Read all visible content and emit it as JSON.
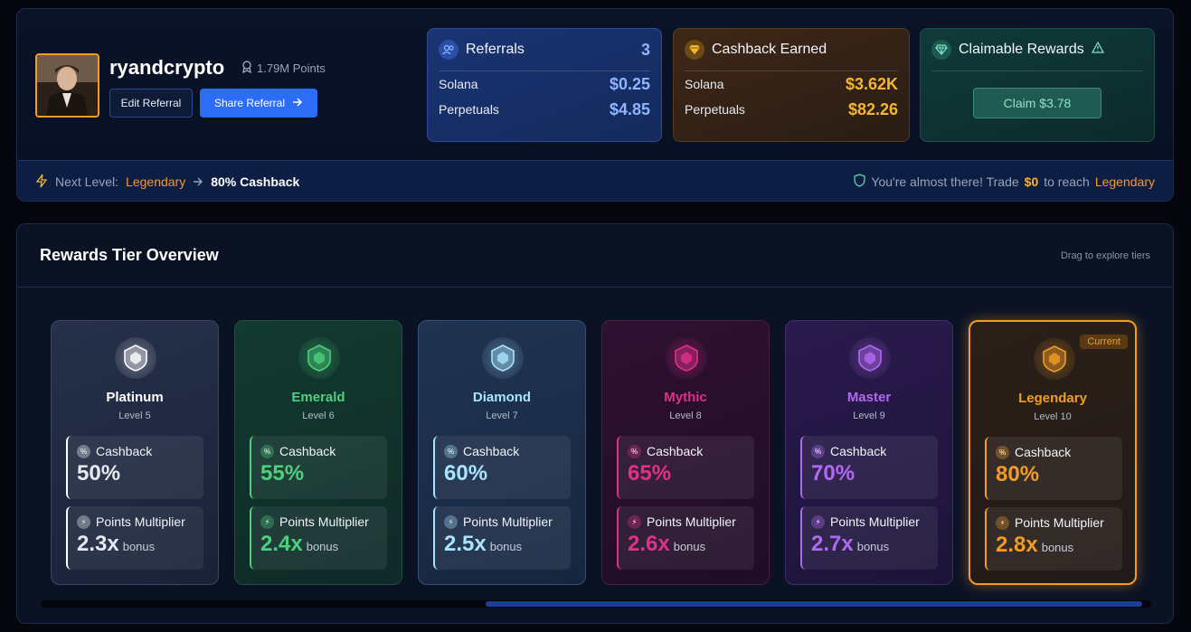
{
  "profile": {
    "username": "ryandcrypto",
    "points": "1.79M Points",
    "edit_label": "Edit Referral",
    "share_label": "Share Referral"
  },
  "referrals": {
    "title": "Referrals",
    "count": "3",
    "rows": [
      {
        "label": "Solana",
        "value": "$0.25"
      },
      {
        "label": "Perpetuals",
        "value": "$4.85"
      }
    ]
  },
  "cashback": {
    "title": "Cashback Earned",
    "rows": [
      {
        "label": "Solana",
        "value": "$3.62K"
      },
      {
        "label": "Perpetuals",
        "value": "$82.26"
      }
    ]
  },
  "claimable": {
    "title": "Claimable Rewards",
    "button_label": "Claim $3.78"
  },
  "next_level": {
    "label": "Next Level:",
    "level": "Legendary",
    "cashback": "80% Cashback",
    "message_prefix": "You're almost there! Trade",
    "amount": "$0",
    "message_mid": "to reach",
    "target": "Legendary"
  },
  "rewards": {
    "title": "Rewards Tier Overview",
    "hint": "Drag to explore tiers",
    "cashback_label": "Cashback",
    "multiplier_label": "Points Multiplier",
    "bonus_label": "bonus",
    "current_badge": "Current",
    "tiers": [
      {
        "name": "Platinum",
        "level": "Level 5",
        "cashback": "50%",
        "multiplier": "2.3x",
        "color": "#ffffff"
      },
      {
        "name": "Emerald",
        "level": "Level 6",
        "cashback": "55%",
        "multiplier": "2.4x",
        "color": "#4cd07d"
      },
      {
        "name": "Diamond",
        "level": "Level 7",
        "cashback": "60%",
        "multiplier": "2.5x",
        "color": "#a9e4ff"
      },
      {
        "name": "Mythic",
        "level": "Level 8",
        "cashback": "65%",
        "multiplier": "2.6x",
        "color": "#e0308a"
      },
      {
        "name": "Master",
        "level": "Level 9",
        "cashback": "70%",
        "multiplier": "2.7x",
        "color": "#b269f2"
      },
      {
        "name": "Legendary",
        "level": "Level 10",
        "cashback": "80%",
        "multiplier": "2.8x",
        "color": "#f29b26"
      }
    ]
  },
  "colors": {
    "accent_blue": "#2d6df6",
    "gold": "#f7b52c",
    "legendary_orange": "#f29b26"
  },
  "icons": {
    "points": "award-icon",
    "share_arrow": "arrow-right-icon",
    "referrals": "users-icon",
    "cashback": "gem-icon",
    "claimable": "diamond-icon",
    "warning": "warning-icon",
    "next_level": "lightning-icon",
    "shield": "shield-icon"
  }
}
